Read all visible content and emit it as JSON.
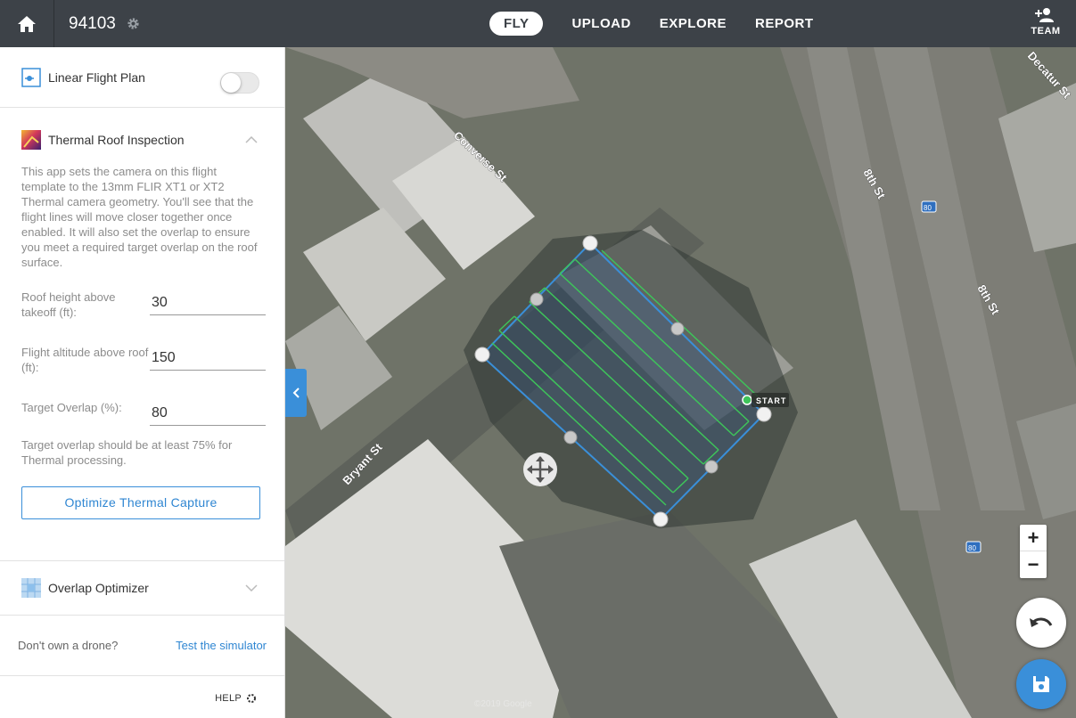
{
  "header": {
    "project_name": "94103",
    "nav": [
      {
        "label": "FLY",
        "active": true
      },
      {
        "label": "UPLOAD",
        "active": false
      },
      {
        "label": "EXPLORE",
        "active": false
      },
      {
        "label": "REPORT",
        "active": false
      }
    ],
    "team_label": "TEAM"
  },
  "sidebar": {
    "linear_flight_plan": {
      "label": "Linear Flight Plan",
      "toggle_on": false
    },
    "thermal": {
      "title": "Thermal Roof Inspection",
      "description": "This app sets the camera on this flight template to the 13mm FLIR XT1 or XT2 Thermal camera geometry. You'll see that the flight lines will move closer together once enabled. It will also set the overlap to ensure you meet a required target overlap on the roof surface.",
      "fields": [
        {
          "label": "Roof height above takeoff (ft):",
          "value": "30"
        },
        {
          "label": "Flight altitude above roof (ft):",
          "value": "150"
        },
        {
          "label": "Target Overlap (%):",
          "value": "80"
        }
      ],
      "note": "Target overlap should be at least 75% for Thermal processing.",
      "button_label": "Optimize Thermal Capture"
    },
    "overlap_optimizer": {
      "label": "Overlap Optimizer"
    },
    "simulator": {
      "question": "Don't own a drone?",
      "link": "Test the simulator"
    },
    "help_label": "HELP"
  },
  "map": {
    "start_label": "START",
    "streets": [
      "Converse St",
      "Bryant St",
      "8th St",
      "8th St",
      "Decatur St"
    ],
    "highway_shield": "80",
    "zoom_in": "+",
    "zoom_out": "−",
    "attribution": "©2019 Google"
  },
  "colors": {
    "topbar": "#3d4248",
    "accent": "#3a8fd9",
    "flight_path": "#3ec45a",
    "boundary": "#3a8fd9"
  }
}
